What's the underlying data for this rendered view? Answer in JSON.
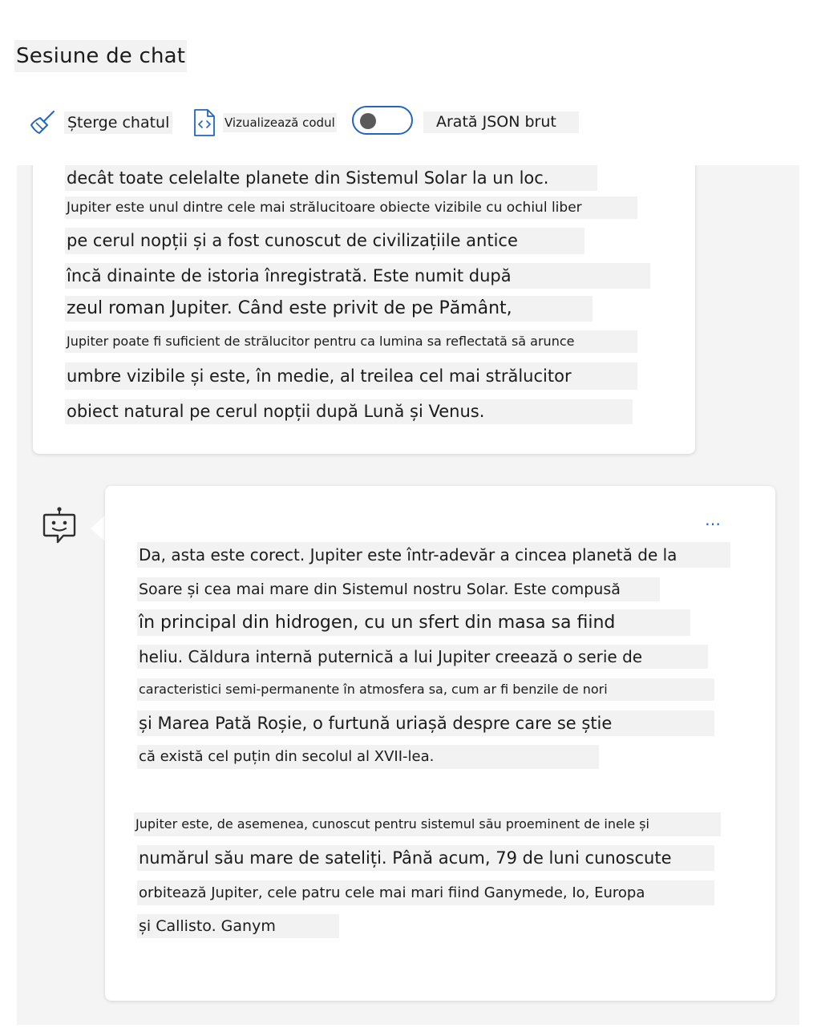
{
  "page": {
    "title": "Sesiune de chat"
  },
  "toolbar": {
    "clear_label": "Șterge chatul",
    "view_code_label": "Vizualizează codul",
    "raw_json_label": "Arată JSON brut",
    "raw_json_enabled": false
  },
  "icons": {
    "clear": "broom-icon",
    "view_code": "code-file-icon",
    "bot": "robot-icon",
    "more": "ellipsis-icon"
  },
  "colors": {
    "accent": "#2266bf",
    "highlight": "#f2f2f2",
    "chat_bg": "#f4f4f4"
  },
  "messages": [
    {
      "role": "user",
      "lines": [
        "decât toate celelalte planete din Sistemul Solar la un loc.",
        "Jupiter este unul dintre cele mai strălucitoare obiecte vizibile cu ochiul liber",
        "pe cerul nopții și a fost cunoscut de civilizațiile antice",
        "încă dinainte de istoria înregistrată. Este numit după",
        "zeul roman Jupiter. Când este privit de pe Pământ,",
        "Jupiter poate fi suficient de strălucitor pentru ca lumina sa reflectată să arunce",
        "umbre vizibile și este, în medie, al treilea cel mai strălucitor",
        "obiect natural pe cerul nopții după Lună și Venus."
      ]
    },
    {
      "role": "assistant",
      "more_label": "…",
      "lines": [
        "Da, asta este corect. Jupiter este într-adevăr a cincea planetă de la",
        "Soare și cea mai mare din Sistemul nostru Solar. Este compusă",
        "în principal din hidrogen, cu un sfert din masa sa fiind",
        "heliu. Căldura internă puternică a lui Jupiter creează o serie de",
        "caracteristici semi-permanente în atmosfera sa, cum ar fi benzile de nori",
        "și Marea Pată Roșie, o furtună uriașă despre care se știe",
        "că există cel puțin din secolul al XVII-lea.",
        "Jupiter este, de asemenea, cunoscut pentru sistemul său proeminent de inele și",
        "numărul său mare de sateliți. Până acum, 79 de luni cunoscute",
        "orbitează Jupiter, cele patru cele mai mari fiind Ganymede, Io, Europa",
        "și Callisto. Ganym"
      ]
    }
  ]
}
